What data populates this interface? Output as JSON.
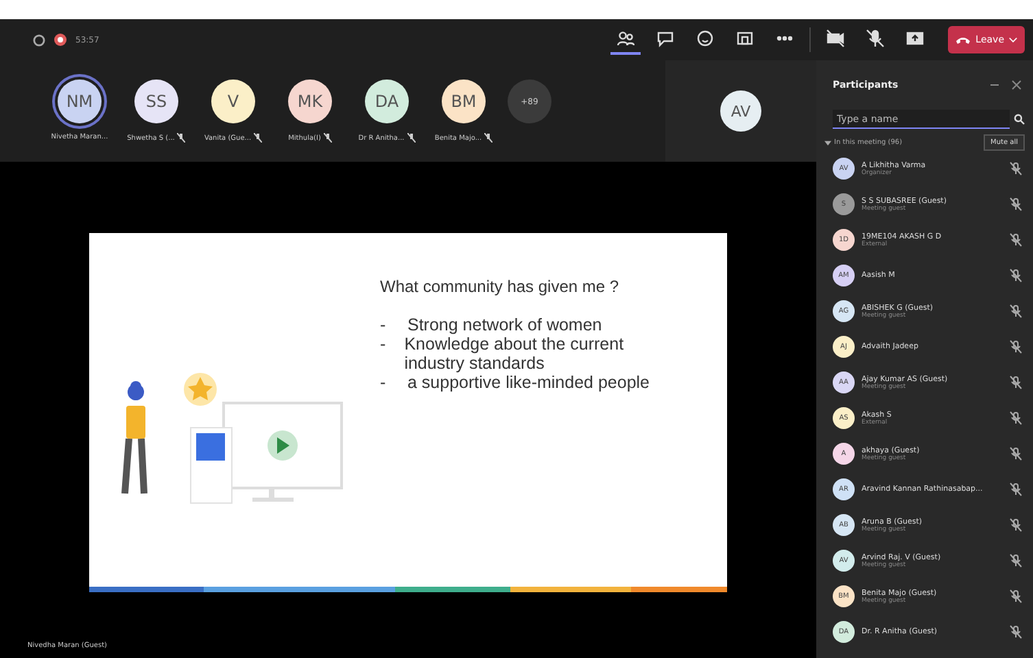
{
  "top_bar": {
    "meeting_time": "53:57",
    "recording": true,
    "buttons": [
      {
        "kind": "people",
        "selected": true
      },
      {
        "kind": "chat",
        "selected": false
      },
      {
        "kind": "react",
        "selected": false
      },
      {
        "kind": "rooms",
        "selected": false
      },
      {
        "kind": "more",
        "selected": false
      }
    ],
    "device_buttons": [
      {
        "kind": "camera"
      },
      {
        "kind": "mic"
      },
      {
        "kind": "share"
      }
    ],
    "leave_button": "Leave"
  },
  "video_strip": [
    {
      "initials": "NM",
      "name": "Nivetha Maran...",
      "color": "#c9d3f2",
      "speaking": true,
      "muted": false
    },
    {
      "initials": "SS",
      "name": "Shwetha S (...",
      "color": "#e6e4f6",
      "speaking": false,
      "muted": true
    },
    {
      "initials": "V",
      "name": "Vanita (Gue...",
      "color": "#fbefc8",
      "speaking": false,
      "muted": true
    },
    {
      "initials": "MK",
      "name": "Mithula(I)",
      "color": "#f6d6cf",
      "speaking": false,
      "muted": true
    },
    {
      "initials": "DA",
      "name": "Dr R Anitha...",
      "color": "#d2ecdd",
      "speaking": false,
      "muted": true
    },
    {
      "initials": "BM",
      "name": "Benita Majo...",
      "color": "#fbe3c6",
      "speaking": false,
      "muted": true
    }
  ],
  "overflow_count": "+89",
  "self_view": {
    "initials": "AV"
  },
  "slide": {
    "title": "What community has given me ?",
    "bullets": [
      {
        "marker": "-",
        "text": "Strong network of women"
      },
      {
        "marker": "-",
        "text": "Knowledge about the current industry standards"
      },
      {
        "marker": "-",
        "text": "a supportive like-minded people"
      }
    ]
  },
  "presenter_label": "Nivedha Maran (Guest)",
  "participants_panel": {
    "title": "Participants",
    "search": {
      "placeholder": "Type a name"
    },
    "section": "In this meeting (96)",
    "expanded": true,
    "mute_all": "Mute all",
    "people": [
      {
        "initials": "AV",
        "name": "A Likhitha Varma",
        "role": "Organizer",
        "color": "#c9d3f2"
      },
      {
        "initials": "S",
        "name": "S S SUBASREE (Guest)",
        "role": "Meeting guest",
        "color": "#9a9a9a"
      },
      {
        "initials": "1D",
        "name": "19ME104 AKASH G D",
        "role": "External",
        "color": "#f6d6cf"
      },
      {
        "initials": "AM",
        "name": "Aasish M",
        "color": "#d6cff4"
      },
      {
        "initials": "AG",
        "name": "ABISHEK G (Guest)",
        "role": "Meeting guest",
        "color": "#d6e6f4"
      },
      {
        "initials": "AJ",
        "name": "Advaith Jadeep",
        "color": "#fbefc8"
      },
      {
        "initials": "AA",
        "name": "Ajay Kumar AS (Guest)",
        "role": "Meeting guest",
        "color": "#d9d7f5"
      },
      {
        "initials": "AS",
        "name": "Akash S",
        "role": "External",
        "color": "#fbefc8"
      },
      {
        "initials": "A",
        "name": "akhaya (Guest)",
        "role": "Meeting guest",
        "color": "#f5d6e8"
      },
      {
        "initials": "AR",
        "name": "Aravind Kannan Rathinasabap...",
        "color": "#cfe1f6"
      },
      {
        "initials": "AB",
        "name": "Aruna B (Guest)",
        "role": "Meeting guest",
        "color": "#d6e6f4"
      },
      {
        "initials": "AV",
        "name": "Arvind Raj. V (Guest)",
        "role": "Meeting guest",
        "color": "#d2ecec"
      },
      {
        "initials": "BM",
        "name": "Benita Majo (Guest)",
        "role": "Meeting guest",
        "color": "#fbe3c6"
      },
      {
        "initials": "DA",
        "name": "Dr. R Anitha (Guest)",
        "color": "#d2ecdd"
      }
    ]
  }
}
